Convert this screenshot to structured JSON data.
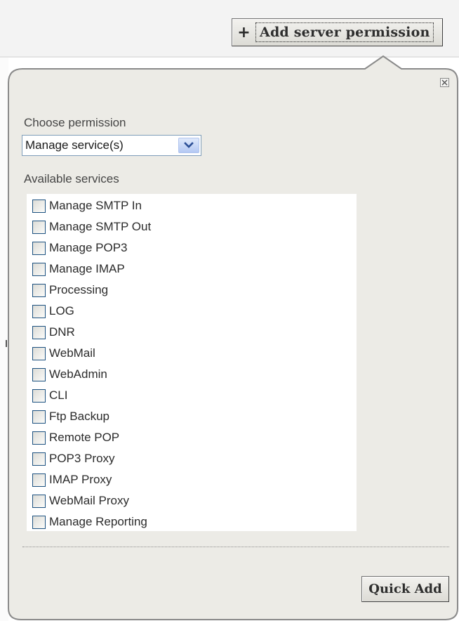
{
  "header": {
    "add_button_icon": "plus-icon",
    "add_button_label": "Add server permission"
  },
  "panel": {
    "close_icon": "close-icon",
    "choose_label": "Choose permission",
    "permission_select": {
      "selected": "Manage service(s)",
      "icon": "chevron-down-icon"
    },
    "services_label": "Available services",
    "services": [
      {
        "label": "Manage SMTP In",
        "checked": false
      },
      {
        "label": "Manage SMTP Out",
        "checked": false
      },
      {
        "label": "Manage POP3",
        "checked": false
      },
      {
        "label": "Manage IMAP",
        "checked": false
      },
      {
        "label": "Processing",
        "checked": false
      },
      {
        "label": "LOG",
        "checked": false
      },
      {
        "label": "DNR",
        "checked": false
      },
      {
        "label": "WebMail",
        "checked": false
      },
      {
        "label": "WebAdmin",
        "checked": false
      },
      {
        "label": "CLI",
        "checked": false
      },
      {
        "label": "Ftp Backup",
        "checked": false
      },
      {
        "label": "Remote POP",
        "checked": false
      },
      {
        "label": "POP3 Proxy",
        "checked": false
      },
      {
        "label": "IMAP Proxy",
        "checked": false
      },
      {
        "label": "WebMail Proxy",
        "checked": false
      },
      {
        "label": "Manage Reporting",
        "checked": false
      }
    ],
    "quick_add_label": "Quick Add"
  },
  "colors": {
    "panel_bg": "#ecebe6",
    "panel_border": "#8a8a8a",
    "checkbox_border": "#1c5180",
    "select_border": "#7f9db9"
  }
}
